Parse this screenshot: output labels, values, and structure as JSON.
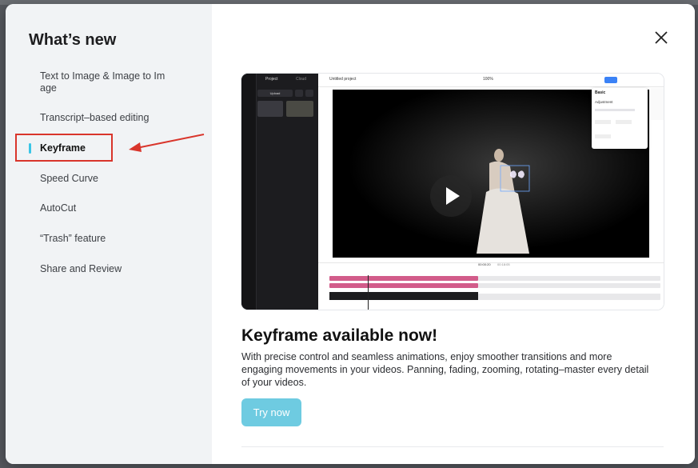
{
  "sidebar": {
    "title": "What’s new",
    "items": [
      {
        "label": "Text to Image & Image to Im age",
        "active": false
      },
      {
        "label": "Transcript–based editing",
        "active": false
      },
      {
        "label": "Keyframe",
        "active": true
      },
      {
        "label": "Speed Curve",
        "active": false
      },
      {
        "label": "AutoCut",
        "active": false
      },
      {
        "label": "“Trash” feature",
        "active": false
      },
      {
        "label": "Share and Review",
        "active": false
      }
    ]
  },
  "main": {
    "close_icon": "close-icon",
    "headline": "Keyframe available now!",
    "description": "With precise control and seamless animations, enjoy smoother transitions and more engaging movements in your videos. Panning, fading, zooming, rotating–master every detail of your videos.",
    "cta_label": "Try now"
  },
  "preview": {
    "tabs": [
      "Project",
      "Cloud"
    ],
    "upload_label": "Upload",
    "project_title": "Untitled project",
    "zoom": "100%",
    "export_label": "Export",
    "panel_title": "Basic",
    "panel_section": "Adjustment",
    "timecode_current": "00:00:20",
    "timecode_total": "00:18:05",
    "play_icon": "play-icon"
  },
  "colors": {
    "accent": "#39c5e6",
    "cta_bg": "#6ecbe1",
    "annotation_red": "#d9352b",
    "track_pink": "#d25c8a"
  }
}
